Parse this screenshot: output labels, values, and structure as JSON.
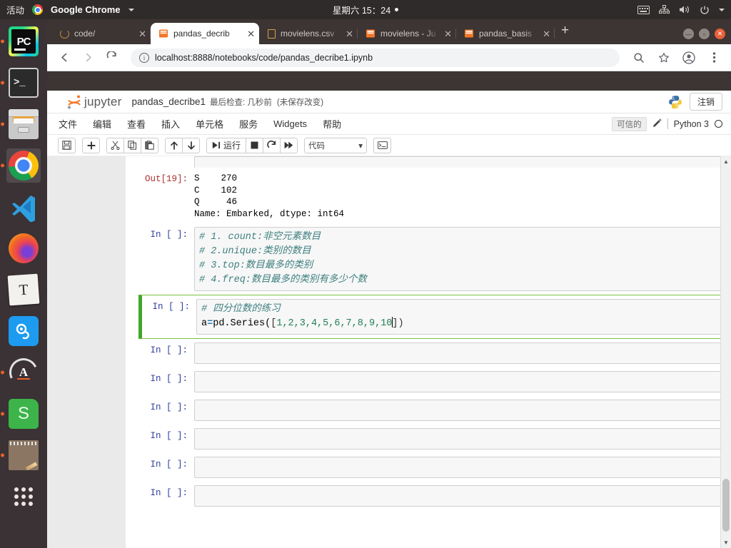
{
  "desktop": {
    "activities": "活动",
    "app_menu": "Google Chrome",
    "clock": "星期六 15：24",
    "tray_icons": [
      "keyboard-icon",
      "network-icon",
      "volume-icon",
      "power-icon"
    ]
  },
  "dock": {
    "items": [
      {
        "name": "pycharm",
        "label": "PC",
        "running": true,
        "active": false
      },
      {
        "name": "terminal",
        "label": ">_",
        "running": true,
        "active": false
      },
      {
        "name": "files",
        "label": "",
        "running": true,
        "active": false
      },
      {
        "name": "chrome",
        "label": "",
        "running": true,
        "active": true
      },
      {
        "name": "vscode",
        "label": "",
        "running": false,
        "active": false
      },
      {
        "name": "firefox",
        "label": "",
        "running": false,
        "active": false
      },
      {
        "name": "text-editor",
        "label": "T",
        "running": false,
        "active": false
      },
      {
        "name": "blue-app",
        "label": "Q",
        "running": false,
        "active": false
      },
      {
        "name": "anaconda",
        "label": "A",
        "running": true,
        "active": false
      },
      {
        "name": "green-s-app",
        "label": "S",
        "running": true,
        "active": false
      },
      {
        "name": "notes",
        "label": "",
        "running": true,
        "active": false
      },
      {
        "name": "show-applications",
        "label": "",
        "running": false,
        "active": false
      }
    ]
  },
  "browser": {
    "tabs": [
      {
        "title": "code/",
        "favicon": "jupyter-circle-icon",
        "active": false
      },
      {
        "title": "pandas_decrib",
        "favicon": "jupyter-book-icon",
        "active": true
      },
      {
        "title": "movielens.csv",
        "favicon": "document-icon",
        "active": false
      },
      {
        "title": "movielens - Ju",
        "favicon": "jupyter-book-icon",
        "active": false
      },
      {
        "title": "pandas_basis",
        "favicon": "jupyter-book-icon",
        "active": false
      }
    ],
    "close_glyph": "✕",
    "new_tab_glyph": "+",
    "url": "localhost:8888/notebooks/code/pandas_decribe1.ipynb",
    "window_controls": [
      "minimize",
      "maximize",
      "close"
    ]
  },
  "jupyter": {
    "brand": "jupyter",
    "notebook_name": "pandas_decribe1",
    "last_checkpoint": "最后检查: 几秒前",
    "dirty_flag": "(未保存改变)",
    "logout_label": "注销",
    "menu": [
      "文件",
      "编辑",
      "查看",
      "插入",
      "单元格",
      "服务",
      "Widgets",
      "帮助"
    ],
    "trusted_label": "可信的",
    "kernel_name": "Python 3",
    "toolbar": {
      "buttons": [
        {
          "name": "save-button",
          "glyph": "💾",
          "title": "保存"
        },
        {
          "name": "insert-cell-button",
          "glyph": "✚",
          "title": "插入单元"
        },
        {
          "name": "cut-cell-button",
          "glyph": "✂",
          "title": "剪切"
        },
        {
          "name": "copy-cell-button",
          "glyph": "⧉",
          "title": "复制"
        },
        {
          "name": "paste-cell-button",
          "glyph": "📋",
          "title": "粘贴"
        },
        {
          "name": "move-up-button",
          "glyph": "↑",
          "title": "上移"
        },
        {
          "name": "move-down-button",
          "glyph": "↓",
          "title": "下移"
        },
        {
          "name": "run-button",
          "glyph": "▶|",
          "title": "运行"
        },
        {
          "name": "interrupt-button",
          "glyph": "■",
          "title": "中断"
        },
        {
          "name": "restart-button",
          "glyph": "⟳",
          "title": "重启"
        },
        {
          "name": "restart-run-all-button",
          "glyph": "⏩",
          "title": "重启并运行"
        }
      ],
      "run_label": "运行",
      "cell_type": "代码",
      "cell_type_caret": "▾",
      "command_palette": "⌨"
    }
  },
  "notebook": {
    "cells": [
      {
        "type": "output-clipped",
        "prompt": "",
        "text": ""
      },
      {
        "type": "output",
        "prompt": "Out[19]:",
        "text": "S    270\nC    102\nQ     46\nName: Embarked, dtype: int64"
      },
      {
        "type": "code",
        "prompt": "In [ ]:",
        "selected": false,
        "lines": [
          "# 1. count:非空元素数目",
          "# 2.unique:类别的数目",
          "# 3.top:数目最多的类别",
          "# 4.freq:数目最多的类别有多少个数"
        ]
      },
      {
        "type": "code",
        "prompt": "In [ ]:",
        "selected": true,
        "comment_line": "# 四分位数的练习",
        "code_var": "a",
        "code_eq": "=",
        "code_call": "pd.Series(",
        "code_open_bracket": "[",
        "code_values": "1,2,3,4,5,6,7,8,9,10",
        "code_close_bracket": "]",
        "code_close_paren": ")"
      },
      {
        "type": "code",
        "prompt": "In [ ]:",
        "selected": false,
        "lines": [
          ""
        ]
      },
      {
        "type": "code",
        "prompt": "In [ ]:",
        "selected": false,
        "lines": [
          ""
        ]
      },
      {
        "type": "code",
        "prompt": "In [ ]:",
        "selected": false,
        "lines": [
          ""
        ]
      },
      {
        "type": "code",
        "prompt": "In [ ]:",
        "selected": false,
        "lines": [
          ""
        ]
      },
      {
        "type": "code",
        "prompt": "In [ ]:",
        "selected": false,
        "lines": [
          ""
        ]
      },
      {
        "type": "code",
        "prompt": "In [ ]:",
        "selected": false,
        "lines": [
          ""
        ]
      }
    ]
  },
  "colors": {
    "selected_cell_border": "#7ac142",
    "comment": "#408080",
    "number": "#208050",
    "in_prompt": "#303f9f",
    "out_prompt": "#b03030",
    "chrome_frame": "#3c3534",
    "dock": "#3a3234"
  }
}
